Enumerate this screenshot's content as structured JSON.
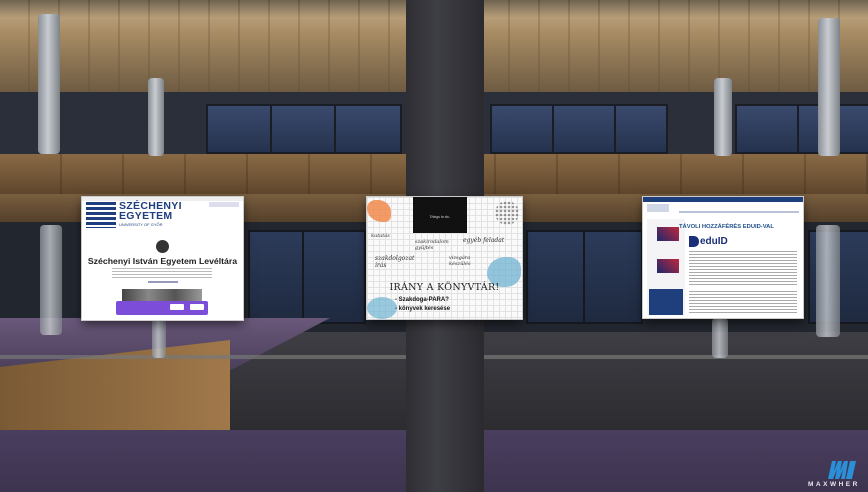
{
  "screens": {
    "left": {
      "logo_line1": "SZÉCHENYI",
      "logo_line2": "EGYETEM",
      "logo_sub": "UNIVERSITY OF GYŐR",
      "title": "Széchenyi István Egyetem Levéltára"
    },
    "center": {
      "top_phrase": "Things to do..",
      "handwritten": [
        "kutatás",
        "szakdolgozat írás",
        "szakirodalom gyűjtés",
        "egyéb feladat",
        "vizsgára készülés"
      ],
      "heading": "IRÁNY A KÖNYVTÁR!",
      "list": [
        "- Szakdoga-PARA?",
        "- könyvek keresése"
      ]
    },
    "right": {
      "title": "TÁVOLI HOZZÁFÉRÉS EDUID-VAL",
      "brand": "eduID"
    }
  },
  "brand_logo": {
    "text": "MAXWHER"
  },
  "colors": {
    "ceiling": "#a88c64",
    "window_glass": "#2c3b5a",
    "floor": "#4a3e5e",
    "logo_blue": "#1e3e7e",
    "eduid_blue": "#1a2f78",
    "accent_orange": "#f08a4b",
    "accent_teal": "#6fb3d2",
    "cookie_purple": "#7b4dd9"
  }
}
